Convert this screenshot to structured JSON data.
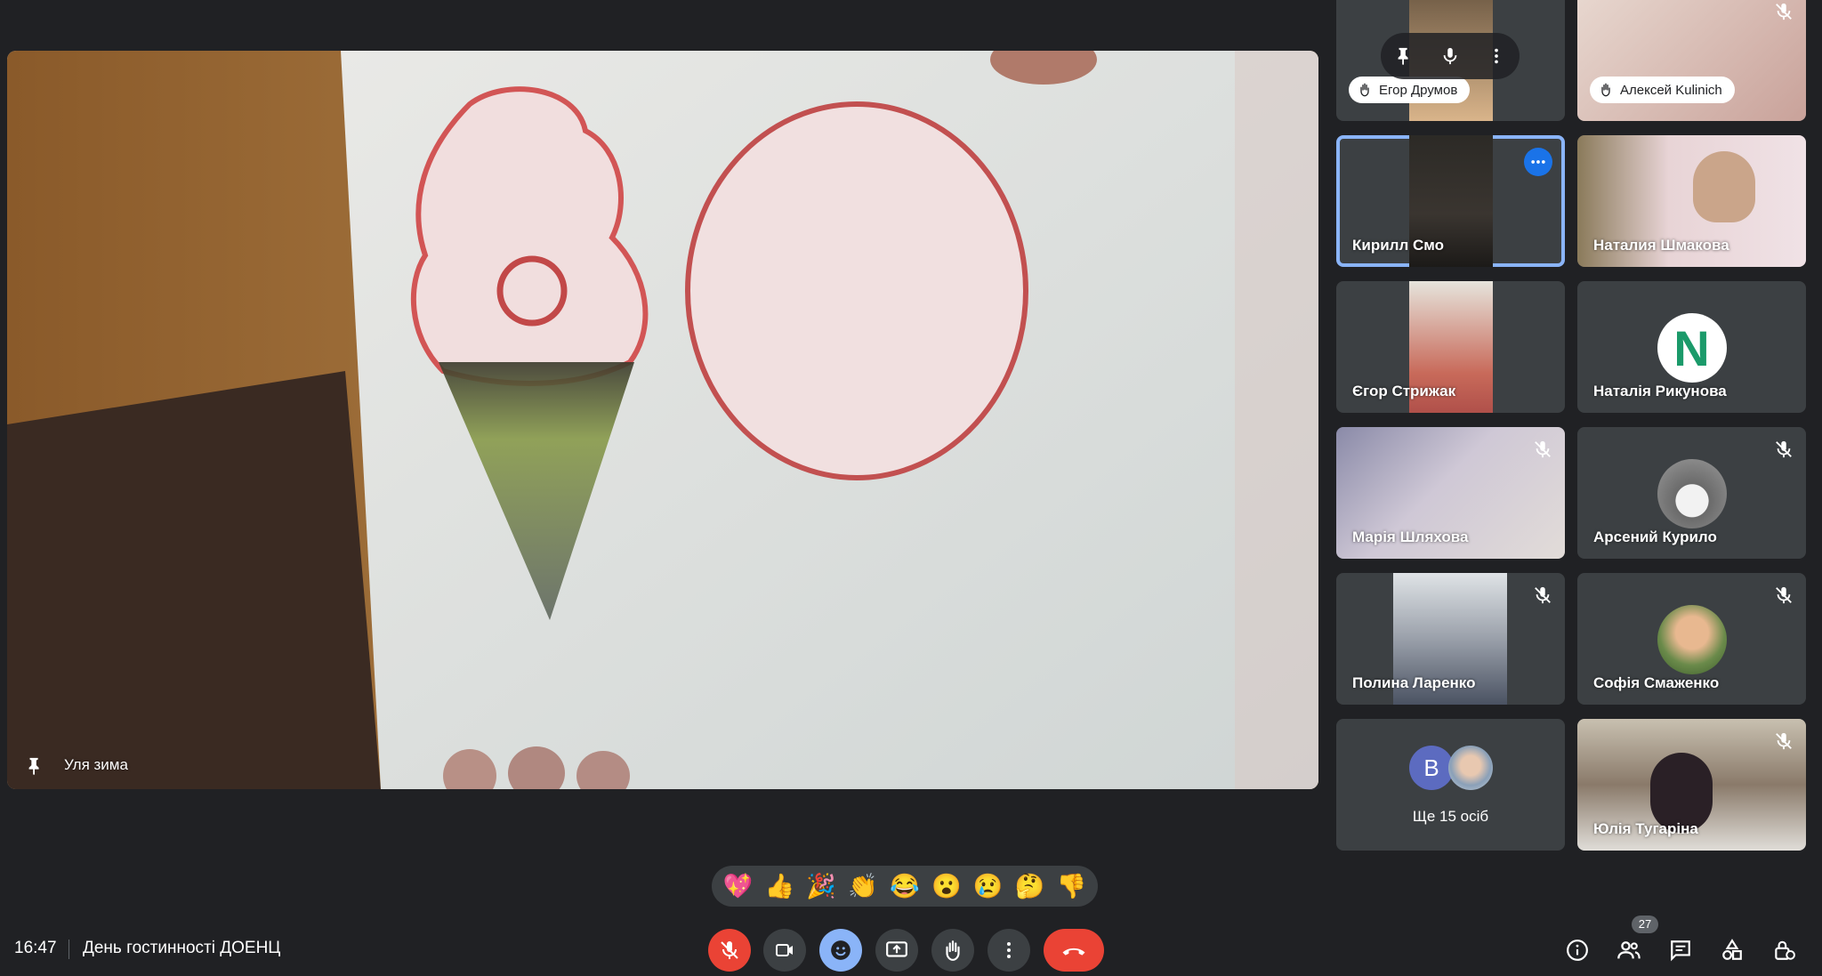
{
  "main": {
    "presenter_name": "Уля зима"
  },
  "tiles": [
    {
      "name": "Егор Друмов",
      "hand_raised": true
    },
    {
      "name": "Алексей Kulinich",
      "hand_raised": true,
      "muted": true
    },
    {
      "name": "Кирилл Смо",
      "selected": true
    },
    {
      "name": "Наталия Шмакова"
    },
    {
      "name": "Єгор Стрижак"
    },
    {
      "name": "Наталія Рикунова",
      "avatar_letter": "N"
    },
    {
      "name": "Марія Шляхова",
      "muted": true
    },
    {
      "name": "Арсений Курило",
      "muted": true
    },
    {
      "name": "Полина Ларенко",
      "muted": true
    },
    {
      "name": "Софія Смаженко",
      "muted": true
    },
    {
      "name": "Юлія Тугаріна",
      "muted": true
    }
  ],
  "more_tile": {
    "label": "Ще 15 осіб",
    "avatar_letter": "B"
  },
  "reactions": [
    "💖",
    "👍",
    "🎉",
    "👏",
    "😂",
    "😮",
    "😢",
    "🤔",
    "👎"
  ],
  "bottom_bar": {
    "time": "16:47",
    "meeting_title": "День гостинності ДОЕНЦ",
    "people_count": "27"
  },
  "colors": {
    "background": "#202124",
    "tile": "#3c4043",
    "accent_blue": "#8ab4f8",
    "danger_red": "#ea4335"
  }
}
